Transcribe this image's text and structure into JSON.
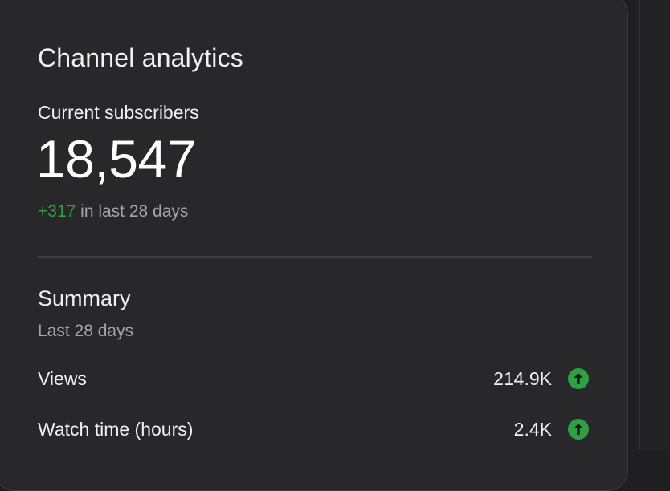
{
  "card": {
    "title": "Channel analytics"
  },
  "subscribers": {
    "label": "Current subscribers",
    "count": "18,547",
    "delta": "+317",
    "period_text": " in last 28 days"
  },
  "summary": {
    "title": "Summary",
    "period": "Last 28 days",
    "rows": [
      {
        "label": "Views",
        "value": "214.9K",
        "trend_icon": "arrow-up-icon"
      },
      {
        "label": "Watch time (hours)",
        "value": "2.4K",
        "trend_icon": "arrow-up-icon"
      }
    ]
  },
  "colors": {
    "card_background": "#28272a",
    "page_background": "#1f1e21",
    "positive": "#2ea043",
    "primary_text": "#f1f1f1",
    "secondary_text": "#a5a5a8"
  }
}
